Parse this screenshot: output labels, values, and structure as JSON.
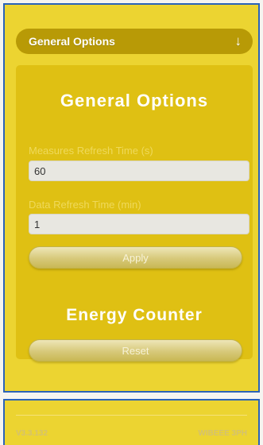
{
  "dropdown": {
    "label": "General Options",
    "arrow": "↓"
  },
  "general": {
    "title": "General Options",
    "measures_label": "Measures Refresh Time (s)",
    "measures_value": "60",
    "data_label": "Data Refresh Time (min)",
    "data_value": "1",
    "apply_label": "Apply"
  },
  "energy": {
    "title": "Energy Counter",
    "reset_label": "Reset"
  },
  "footer": {
    "version": "V3.3.132",
    "device": "WIBEEE 3PH"
  },
  "colors": {
    "background": "#ecd431",
    "panel": "#dfc013",
    "dropdown": "#b89a06",
    "border": "#2b63b8"
  }
}
